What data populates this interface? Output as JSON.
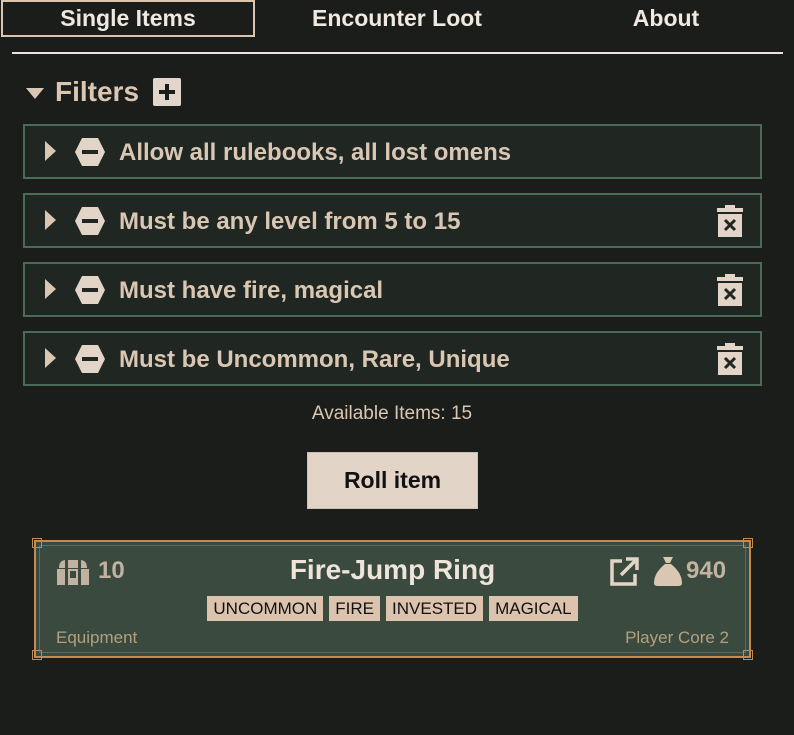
{
  "tabs": [
    {
      "label": "Single Items",
      "active": true
    },
    {
      "label": "Encounter Loot",
      "active": false
    },
    {
      "label": "About",
      "active": false
    }
  ],
  "filters": {
    "title": "Filters",
    "items": [
      {
        "label": "Allow all rulebooks, all lost omens",
        "deletable": false
      },
      {
        "label": "Must be any level from 5 to 15",
        "deletable": true
      },
      {
        "label": "Must have fire, magical",
        "deletable": true
      },
      {
        "label": "Must be Uncommon, Rare, Unique",
        "deletable": true
      }
    ]
  },
  "available": "Available Items: 15",
  "roll_button": "Roll item",
  "item": {
    "level": "10",
    "name": "Fire-Jump Ring",
    "price": "940",
    "traits": [
      "UNCOMMON",
      "FIRE",
      "INVESTED",
      "MAGICAL"
    ],
    "category": "Equipment",
    "source": "Player Core 2"
  },
  "colors": {
    "background": "#1b1d1a",
    "text": "#d9c7b4",
    "filter_border": "#4b6a57",
    "card_bg": "#3a4a3e",
    "card_border": "#c58a4e",
    "trait_bg": "#dcc3ae"
  },
  "icons": {
    "toggle": "hexagon-minus-icon",
    "delete": "trash-icon",
    "add": "plus-icon",
    "level": "chest-icon",
    "price": "coin-bag-icon",
    "link": "external-link-icon"
  }
}
